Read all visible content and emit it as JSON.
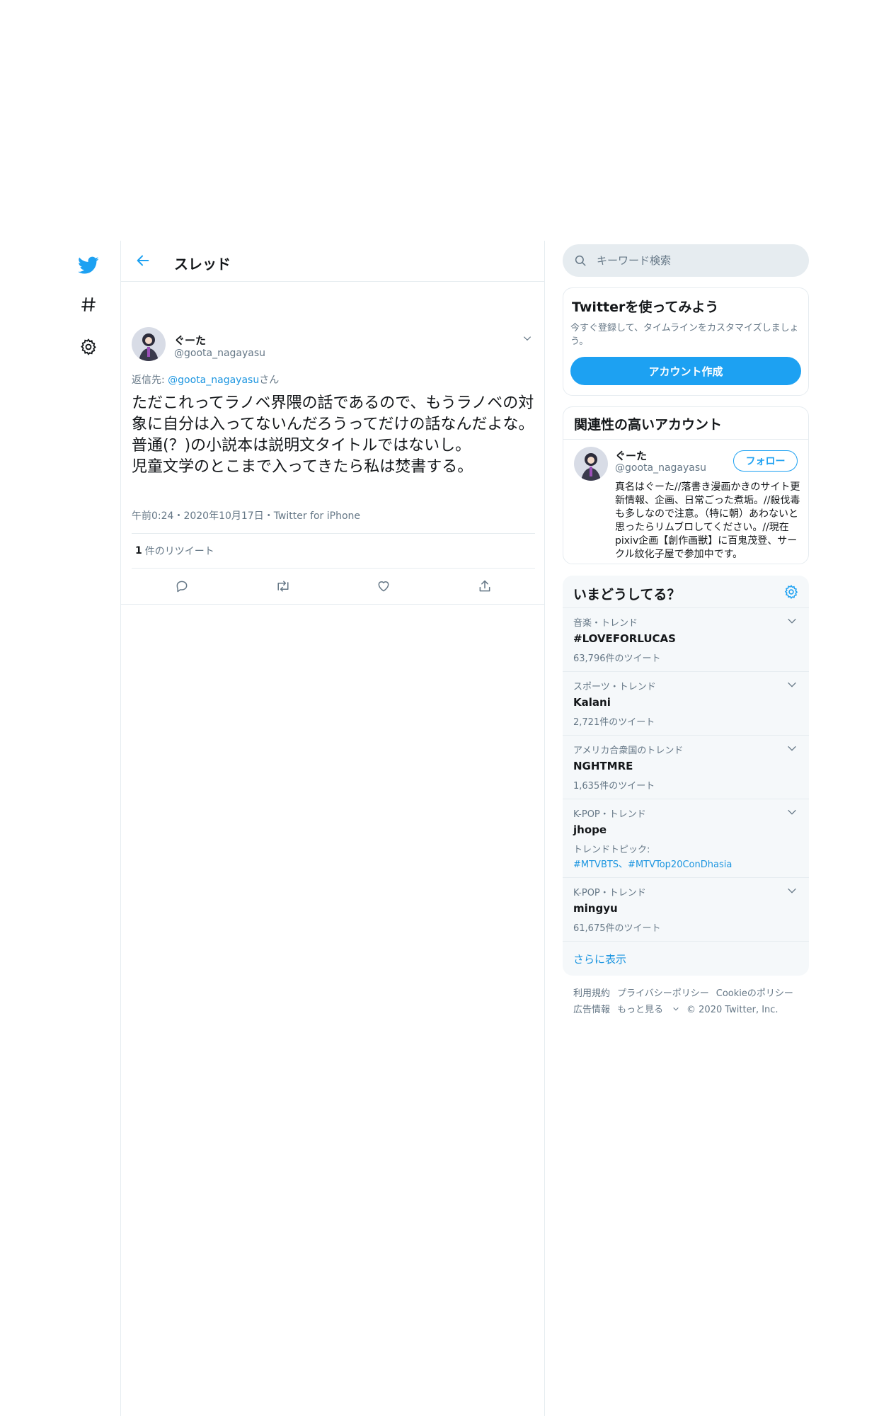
{
  "header": {
    "title": "スレッド"
  },
  "tweet": {
    "author_name": "ぐーた",
    "author_handle": "@goota_nagayasu",
    "reply_to_prefix": "返信先: ",
    "reply_to_handle": "@goota_nagayasu",
    "reply_to_suffix": "さん",
    "text": "ただこれってラノベ界隈の話であるので、もうラノベの対象に自分は入ってないんだろうってだけの話なんだよな。普通(？)の小説本は説明文タイトルではないし。\n児童文学のとこまで入ってきたら私は焚書する。",
    "meta": "午前0:24・2020年10月17日・Twitter for iPhone",
    "retweet_count": "1",
    "retweet_label": "件のリツイート"
  },
  "search": {
    "placeholder": "キーワード検索"
  },
  "signup": {
    "title": "Twitterを使ってみよう",
    "description": "今すぐ登録して、タイムラインをカスタマイズしましょう。",
    "button": "アカウント作成"
  },
  "related": {
    "title": "関連性の高いアカウント",
    "name": "ぐーた",
    "handle": "@goota_nagayasu",
    "follow_label": "フォロー",
    "bio": "真名はぐーた//落書き漫画かきのサイト更新情報、企画、日常ごった煮垢。//殺伐毒も多しなので注意。（特に朝）あわないと思ったらリムブロしてください。//現在pixiv企画【創作画獣】に百鬼茂登、サークル紋化子屋で参加中です。"
  },
  "trends": {
    "title": "いまどうしてる？",
    "items": [
      {
        "category": "音楽・トレンド",
        "name": "#LOVEFORLUCAS",
        "count": "63,796件のツイート"
      },
      {
        "category": "スポーツ・トレンド",
        "name": "Kalani",
        "count": "2,721件のツイート"
      },
      {
        "category": "アメリカ合衆国のトレンド",
        "name": "NGHTMRE",
        "count": "1,635件のツイート"
      },
      {
        "category": "K-POP・トレンド",
        "name": "jhope",
        "topic_label": "トレンドトピック:",
        "topic_tags": "#MTVBTS、#MTVTop20ConDhasia"
      },
      {
        "category": "K-POP・トレンド",
        "name": "mingyu",
        "count": "61,675件のツイート"
      }
    ],
    "show_more": "さらに表示"
  },
  "footer": {
    "links": [
      "利用規約",
      "プライバシーポリシー",
      "Cookieのポリシー",
      "広告情報",
      "もっと見る"
    ],
    "copyright": "© 2020 Twitter, Inc."
  },
  "colors": {
    "accent": "#1da1f2",
    "link": "#1b95e0",
    "muted": "#657786",
    "border": "#e6ecf0"
  }
}
